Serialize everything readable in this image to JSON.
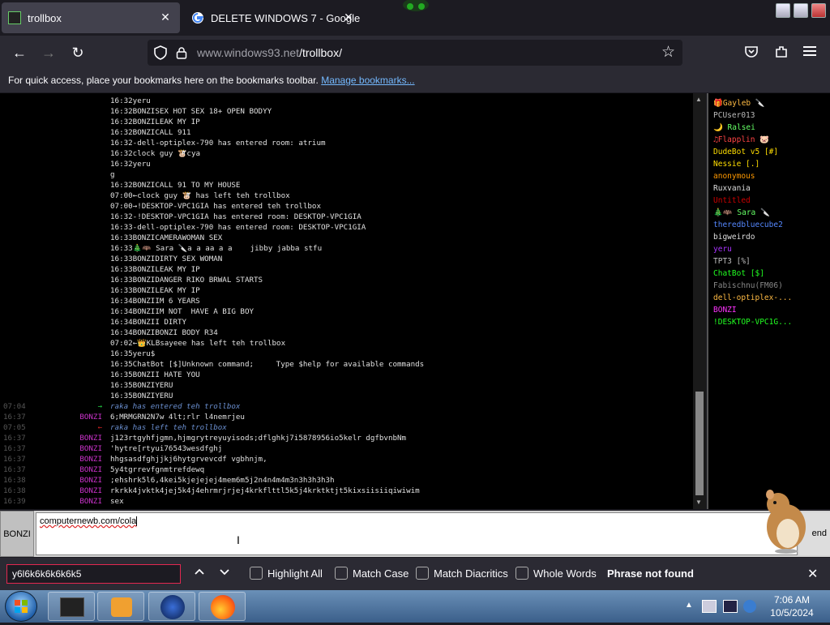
{
  "tabs": [
    {
      "title": "trollbox",
      "close": "✕"
    },
    {
      "title": "DELETE WINDOWS 7 - Google",
      "close": "✕"
    }
  ],
  "nav": {
    "back": "←",
    "forward": "→",
    "reload": "↻",
    "url_host": "www.windows93.net",
    "url_path": "/trollbox/",
    "bookmark_star": "☆"
  },
  "bookmarks_bar": {
    "text": "For quick access, place your bookmarks here on the bookmarks toolbar.",
    "link": "Manage bookmarks..."
  },
  "chat_lines": [
    {
      "nick": "",
      "text": "16:32yeru",
      "color": "#e0e0e0"
    },
    {
      "nick": "",
      "text": "16:32BONZISEX HOT SEX 18+ OPEN BODYY",
      "color": "#e0e0e0"
    },
    {
      "nick": "",
      "text": "16:32BONZILEAK MY IP",
      "color": "#e0e0e0"
    },
    {
      "nick": "",
      "text": "16:32BONZICALL 911",
      "color": "#e0e0e0"
    },
    {
      "nick": "",
      "text": "16:32-dell-optiplex-790 has entered room: atrium",
      "color": "#e0e0e0"
    },
    {
      "nick": "",
      "text": "16:32clock guy 🐮cya",
      "color": "#e0e0e0"
    },
    {
      "nick": "",
      "text": "16:32yeru",
      "color": "#e0e0e0"
    },
    {
      "nick": "",
      "text": "g",
      "color": "#e0e0e0"
    },
    {
      "nick": "",
      "text": "16:32BONZICALL 91 TO MY HOUSE",
      "color": "#e0e0e0"
    },
    {
      "nick": "",
      "text": "07:00←clock guy 🐮 has left teh trollbox",
      "color": "#e0e0e0"
    },
    {
      "nick": "",
      "text": "07:00→!DESKTOP-VPC1GIA has entered teh trollbox",
      "color": "#e0e0e0"
    },
    {
      "nick": "",
      "text": "16:32-!DESKTOP-VPC1GIA has entered room: DESKTOP-VPC1GIA",
      "color": "#e0e0e0"
    },
    {
      "nick": "",
      "text": "16:33-dell-optiplex-790 has entered room: DESKTOP-VPC1GIA",
      "color": "#e0e0e0"
    },
    {
      "nick": "",
      "text": "16:33BONZICAMERAWOMAN SEX",
      "color": "#e0e0e0"
    },
    {
      "nick": "",
      "text": "16:33🎄🦇 Sara 🔪a a aa a a    jibby jabba stfu",
      "color": "#e0e0e0"
    },
    {
      "nick": "",
      "text": "16:33BONZIDIRTY SEX WOMAN",
      "color": "#e0e0e0"
    },
    {
      "nick": "",
      "text": "16:33BONZILEAK MY IP",
      "color": "#e0e0e0"
    },
    {
      "nick": "",
      "text": "16:33BONZIDANGER RIKO BRWAL STARTS",
      "color": "#e0e0e0"
    },
    {
      "nick": "",
      "text": "16:33BONZILEAK MY IP",
      "color": "#e0e0e0"
    },
    {
      "nick": "",
      "text": "16:34BONZIIM 6 YEARS",
      "color": "#e0e0e0"
    },
    {
      "nick": "",
      "text": "16:34BONZIIM NOT  HAVE A BIG BOY",
      "color": "#e0e0e0"
    },
    {
      "nick": "",
      "text": "16:34BONZII DIRTY",
      "color": "#e0e0e0"
    },
    {
      "nick": "",
      "text": "16:34BONZIBONZI BODY R34",
      "color": "#e0e0e0"
    },
    {
      "nick": "",
      "text": "07:02←👑KLBsayeee has left teh trollbox",
      "color": "#e0e0e0"
    },
    {
      "nick": "",
      "text": "16:35yeru$",
      "color": "#e0e0e0"
    },
    {
      "nick": "",
      "text": "16:35ChatBot [$]Unknown command;     Type $help for available commands",
      "color": "#e0e0e0"
    },
    {
      "nick": "",
      "text": "16:35BONZII HATE YOU",
      "color": "#e0e0e0"
    },
    {
      "nick": "",
      "text": "16:35BONZIYERU",
      "color": "#e0e0e0"
    },
    {
      "nick": "",
      "text": "16:35BONZIYERU",
      "color": "#e0e0e0"
    }
  ],
  "chat_rows": [
    {
      "time": "07:04",
      "nick": "→",
      "nick_color": "#22cc44",
      "text": "raka has entered teh trollbox",
      "text_color": "#6a8fd0",
      "italic": true
    },
    {
      "time": "16:37",
      "nick": "BONZI",
      "nick_color": "#cc33cc",
      "text": "6;MRMGRN2N7w 4lt;rlr l4nemrjeu",
      "text_color": "#e0e0e0",
      "italic": false
    },
    {
      "time": "07:05",
      "nick": "←",
      "nick_color": "#cc2222",
      "text": "raka has left teh trollbox",
      "text_color": "#6a8fd0",
      "italic": true
    },
    {
      "time": "16:37",
      "nick": "BONZI",
      "nick_color": "#cc33cc",
      "text": "j123rtgyhfjgmn,hjmgrytreyuyisods;dflghkj7i5878956io5kelr dgfbvnbNm",
      "text_color": "#e0e0e0",
      "italic": false
    },
    {
      "time": "16:37",
      "nick": "BONZI",
      "nick_color": "#cc33cc",
      "text": "'hytre[rtyui76543wesdfghj",
      "text_color": "#e0e0e0",
      "italic": false
    },
    {
      "time": "16:37",
      "nick": "BONZI",
      "nick_color": "#cc33cc",
      "text": "hhgsasdfghjjkj6hytgrvevcdf vgbhnjm,",
      "text_color": "#e0e0e0",
      "italic": false
    },
    {
      "time": "16:37",
      "nick": "BONZI",
      "nick_color": "#cc33cc",
      "text": "5y4tgrrevfgnmtrefdewq",
      "text_color": "#e0e0e0",
      "italic": false
    },
    {
      "time": "16:38",
      "nick": "BONZI",
      "nick_color": "#cc33cc",
      "text": ";ehshrk5l6,4kei5kjejejej4mem6m5j2n4n4m4m3n3h3h3h3h",
      "text_color": "#e0e0e0",
      "italic": false
    },
    {
      "time": "16:38",
      "nick": "BONZI",
      "nick_color": "#cc33cc",
      "text": "rkrkk4jvktk4jej5k4j4ehrmrjrjej4krkflttl5k5j4krktktjt5kixsiisiiqiwiwim",
      "text_color": "#e0e0e0",
      "italic": false
    },
    {
      "time": "16:39",
      "nick": "BONZI",
      "nick_color": "#cc33cc",
      "text": "sex",
      "text_color": "#e0e0e0",
      "italic": false
    }
  ],
  "users": [
    {
      "name": "🎁Gayleb 🔪",
      "color": "#ffbb44"
    },
    {
      "name": "PCUser013",
      "color": "#bbbbbb"
    },
    {
      "name": "🌙 Ralsei",
      "color": "#66ff66"
    },
    {
      "name": "♫Flapplin 🐷",
      "color": "#ff4444"
    },
    {
      "name": "DudeBot v5 [#]",
      "color": "#ffdd00"
    },
    {
      "name": "Nessie [.]",
      "color": "#ffdd00"
    },
    {
      "name": "anonymous",
      "color": "#ff9900"
    },
    {
      "name": "Ruxvania",
      "color": "#dddddd"
    },
    {
      "name": "Untitled",
      "color": "#cc0000"
    },
    {
      "name": "🎄🦇 Sara 🔪",
      "color": "#66ff66"
    },
    {
      "name": "theredbluecube2",
      "color": "#5588ff"
    },
    {
      "name": "bigweirdo",
      "color": "#dddddd"
    },
    {
      "name": "yeru",
      "color": "#aa33ff"
    },
    {
      "name": "TPT3 [%]",
      "color": "#bbbbbb"
    },
    {
      "name": "ChatBot [$]",
      "color": "#22ff22"
    },
    {
      "name": "Fabischnu(FM06)",
      "color": "#888888"
    },
    {
      "name": "dell-optiplex-...",
      "color": "#ffbb44"
    },
    {
      "name": "BONZI",
      "color": "#ff33ff"
    },
    {
      "name": "!DESKTOP-VPC1G...",
      "color": "#22ff22"
    }
  ],
  "input": {
    "nick": "BONZI",
    "value": "computernewb.com/cola",
    "send": "end"
  },
  "findbar": {
    "value": "y6l6k6k6k6k6k5",
    "highlight_all": "Highlight All",
    "match_case": "Match Case",
    "match_diacritics": "Match Diacritics",
    "whole_words": "Whole Words",
    "status": "Phrase not found",
    "close": "✕"
  },
  "taskbar": {
    "time": "7:06 AM",
    "date": "10/5/2024"
  },
  "colors": {
    "accent_link": "#74b9ff",
    "find_border": "#e22850"
  }
}
